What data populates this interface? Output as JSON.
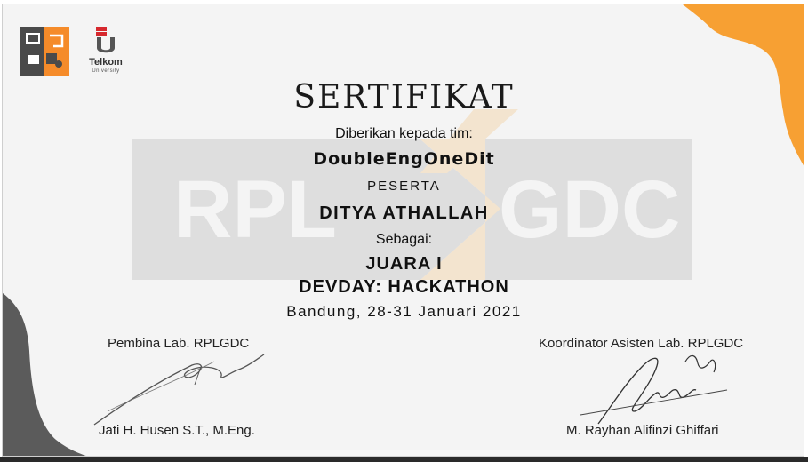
{
  "certificate": {
    "title": "SERTIFIKAT",
    "given_to": "Diberikan kepada tim:",
    "team_name": "DoubleEngOneDit",
    "role": "PESERTA",
    "participant_name": "DITYA ATHALLAH",
    "as_label": "Sebagai:",
    "rank": "JUARA I",
    "event": "DEVDAY: HACKATHON",
    "place_date": "Bandung, 28-31 Januari 2021"
  },
  "logos": {
    "telkom_name": "Telkom",
    "telkom_sub": "University"
  },
  "watermark": {
    "left_text": "RPL",
    "right_text": "GDC"
  },
  "signatures": {
    "left_title": "Pembina Lab. RPLGDC",
    "left_name": "Jati H. Husen S.T., M.Eng.",
    "right_title": "Koordinator Asisten Lab. RPLGDC",
    "right_name": "M. Rayhan Alifinzi Ghiffari"
  },
  "colors": {
    "accent_orange": "#f7a033",
    "dark_gray": "#5b5b5b",
    "background": "#f4f4f4",
    "telkom_red": "#d6282d"
  }
}
